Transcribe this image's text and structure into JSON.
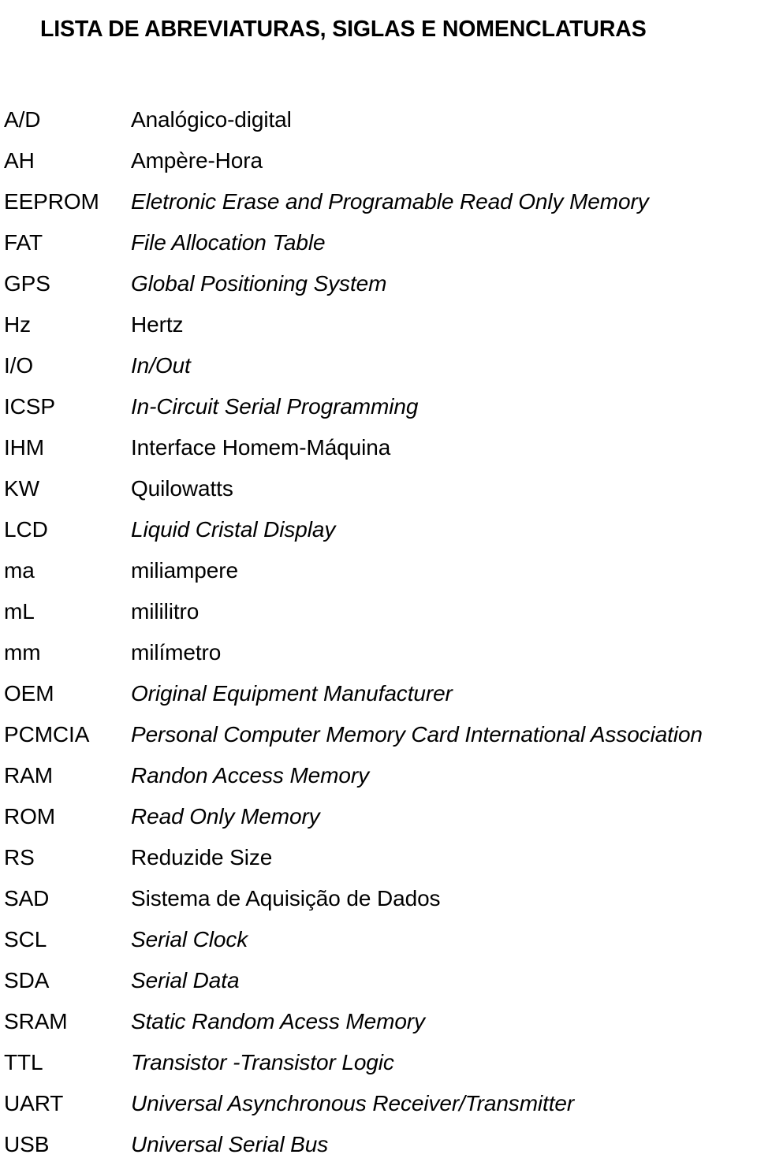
{
  "document": {
    "title": "LISTA DE ABREVIATURAS, SIGLAS E NOMENCLATURAS",
    "page_background": "#ffffff",
    "text_color": "#000000"
  },
  "abbreviations": [
    {
      "term": "A/D",
      "definition": "Analógico-digital",
      "italic": false
    },
    {
      "term": "AH",
      "definition": "Ampère-Hora",
      "italic": false
    },
    {
      "term": "EEPROM",
      "definition": "Eletronic Erase and Programable Read Only Memory",
      "italic": true
    },
    {
      "term": "FAT",
      "definition": "File Allocation Table",
      "italic": true
    },
    {
      "term": "GPS",
      "definition": "Global Positioning System",
      "italic": true
    },
    {
      "term": "Hz",
      "definition": "Hertz",
      "italic": false
    },
    {
      "term": "I/O",
      "definition": "In/Out",
      "italic": true
    },
    {
      "term": "ICSP",
      "definition": "In-Circuit Serial Programming",
      "italic": true
    },
    {
      "term": "IHM",
      "definition": "Interface Homem-Máquina",
      "italic": false
    },
    {
      "term": "KW",
      "definition": "Quilowatts",
      "italic": false
    },
    {
      "term": "LCD",
      "definition": "Liquid Cristal Display",
      "italic": true
    },
    {
      "term": "ma",
      "definition": "miliampere",
      "italic": false
    },
    {
      "term": "mL",
      "definition": "mililitro",
      "italic": false
    },
    {
      "term": "mm",
      "definition": "milímetro",
      "italic": false
    },
    {
      "term": "OEM",
      "definition": "Original Equipment Manufacturer",
      "italic": true
    },
    {
      "term": "PCMCIA",
      "definition": "Personal Computer Memory Card International Association",
      "italic": true
    },
    {
      "term": "RAM",
      "definition": "Randon Access Memory",
      "italic": true
    },
    {
      "term": "ROM",
      "definition": "Read Only Memory",
      "italic": true
    },
    {
      "term": "RS",
      "definition": "Reduzide Size",
      "italic": false
    },
    {
      "term": "SAD",
      "definition": "Sistema de Aquisição de Dados",
      "italic": false
    },
    {
      "term": "SCL",
      "definition": "Serial Clock",
      "italic": true
    },
    {
      "term": "SDA",
      "definition": "Serial Data",
      "italic": true
    },
    {
      "term": "SRAM",
      "definition": "Static Random Acess Memory",
      "italic": true
    },
    {
      "term": "TTL",
      "definition": "Transistor -Transistor Logic",
      "italic": true
    },
    {
      "term": "UART",
      "definition": "Universal Asynchronous Receiver/Transmitter",
      "italic": true
    },
    {
      "term": "USB",
      "definition": "Universal Serial Bus",
      "italic": true
    }
  ]
}
